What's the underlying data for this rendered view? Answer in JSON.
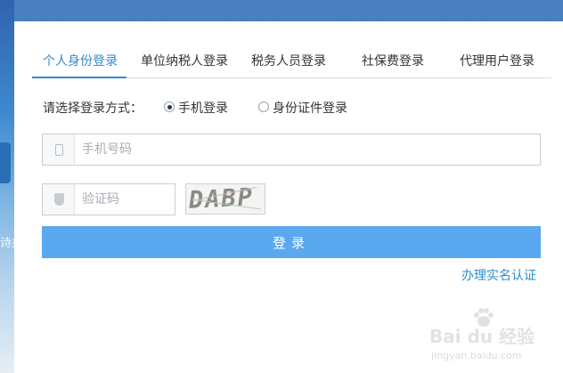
{
  "tabs": [
    {
      "label": "个人身份登录",
      "active": true
    },
    {
      "label": "单位纳税人登录",
      "active": false
    },
    {
      "label": "税务人员登录",
      "active": false
    },
    {
      "label": "社保费登录",
      "active": false
    },
    {
      "label": "代理用户登录",
      "active": false
    }
  ],
  "login_method": {
    "label": "请选择登录方式：",
    "options": [
      {
        "label": "手机登录",
        "selected": true
      },
      {
        "label": "身份证件登录",
        "selected": false
      }
    ]
  },
  "phone_field": {
    "placeholder": "手机号码",
    "value": "",
    "icon": "phone-icon"
  },
  "captcha_field": {
    "placeholder": "验证码",
    "value": "",
    "icon": "shield-icon"
  },
  "captcha_image": {
    "text": "DABP"
  },
  "login_button": {
    "label": "登录"
  },
  "realname_link": {
    "label": "办理实名认证"
  },
  "background": {
    "side_text": "诗办"
  },
  "watermark": {
    "brand": "Bai du 经验",
    "url": "jingyan.baidu.com"
  },
  "colors": {
    "accent": "#2f8ccd",
    "button": "#5aa9f0",
    "border": "#c9cdd3"
  }
}
